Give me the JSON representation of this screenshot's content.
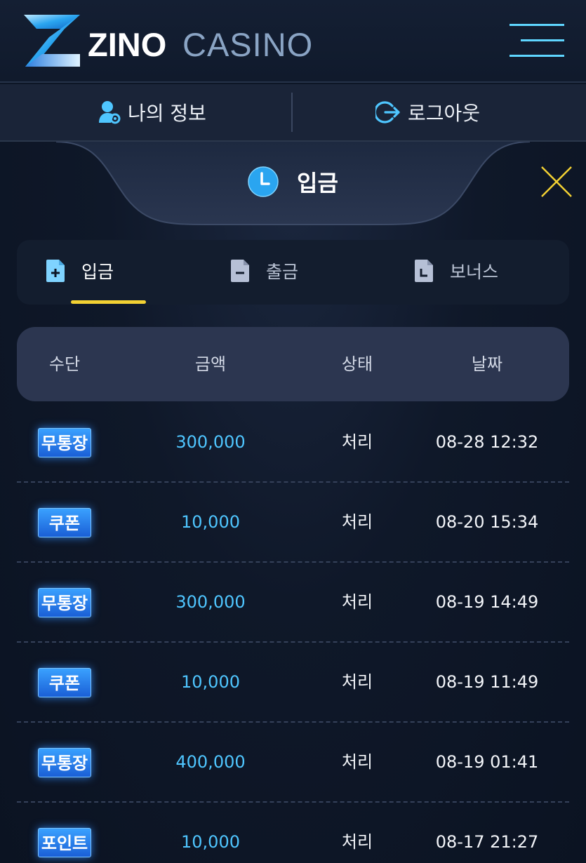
{
  "header": {
    "brand_primary": "ZINO",
    "brand_secondary": "CASINO",
    "menu_icon": "hamburger-menu-icon"
  },
  "userbar": {
    "my_info_label": "나의 정보",
    "logout_label": "로그아웃"
  },
  "panel": {
    "title": "입금",
    "title_icon": "clock-icon",
    "close_icon": "close-icon"
  },
  "tabs": [
    {
      "label": "입금",
      "icon": "file-plus-icon",
      "active": true
    },
    {
      "label": "출금",
      "icon": "file-minus-icon",
      "active": false
    },
    {
      "label": "보너스",
      "icon": "file-clock-icon",
      "active": false
    }
  ],
  "table": {
    "headers": [
      "수단",
      "금액",
      "상태",
      "날짜"
    ],
    "rows": [
      {
        "method": "무통장",
        "amount": "300,000",
        "status": "처리",
        "date": "08-28 12:32"
      },
      {
        "method": "쿠폰",
        "amount": "10,000",
        "status": "처리",
        "date": "08-20 15:34"
      },
      {
        "method": "무통장",
        "amount": "300,000",
        "status": "처리",
        "date": "08-19 14:49"
      },
      {
        "method": "쿠폰",
        "amount": "10,000",
        "status": "처리",
        "date": "08-19 11:49"
      },
      {
        "method": "무통장",
        "amount": "400,000",
        "status": "처리",
        "date": "08-19 01:41"
      },
      {
        "method": "포인트",
        "amount": "10,000",
        "status": "처리",
        "date": "08-17 21:27"
      }
    ]
  },
  "colors": {
    "accent_cyan": "#4fc6ff",
    "tab_underline": "#f3d133",
    "badge_blue": "#1a5fd6",
    "close_yellow": "#f3d133"
  }
}
